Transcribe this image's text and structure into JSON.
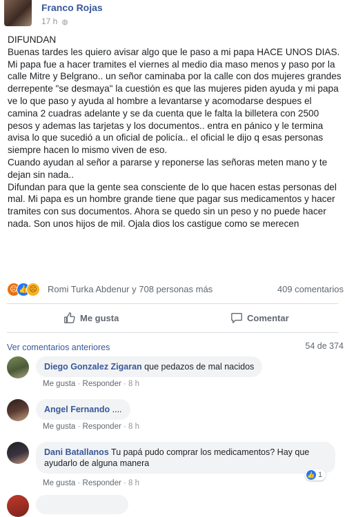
{
  "post": {
    "author": "Franco Rojas",
    "time": "17 h",
    "paragraphs": [
      "DIFUNDAN",
      "Buenas tardes les quiero avisar algo que le paso a mi papa HACE UNOS DIAS.",
      "Mi papa fue a hacer tramites el viernes al medio dia maso menos y paso por la calle Mitre y Belgrano.. un señor caminaba por la calle con dos mujeres grandes derrepente \"se desmaya\" la cuestión es que las mujeres piden ayuda y mi papa ve lo que paso y ayuda al hombre a levantarse y acomodarse despues el camina 2 cuadras adelante y se da cuenta que le falta la billetera con 2500 pesos y ademas las tarjetas y los documentos.. entra en pánico y le termina avisa lo que sucedió a un oficial de policía.. el oficial le dijo q esas personas siempre hacen lo mismo viven de eso.",
      "Cuando ayudan al señor a pararse y reponerse las señoras meten mano y te dejan sin nada..",
      "Difundan para que la gente sea consciente de lo que hacen estas personas del mal. Mi papa es un hombre grande tiene que pagar sus medicamentos y hacer tramites con sus documentos. Ahora se quedo sin un peso y no puede hacer nada. Son unos hijos de mil. Ojala dios los castigue como se merecen"
    ],
    "reactions_text": "Romi Turka Abdenur y 708 personas más",
    "comments_count": "409 comentarios"
  },
  "actions": {
    "like": "Me gusta",
    "comment": "Comentar"
  },
  "comments_section": {
    "previous_link": "Ver comentarios anteriores",
    "page_count": "54 de 374",
    "items": [
      {
        "name": "Diego Gonzalez Zigaran",
        "text": "que pedazos de mal nacidos",
        "like": "Me gusta",
        "reply": "Responder",
        "time": "8 h"
      },
      {
        "name": "Angel Fernando",
        "text": "....",
        "like": "Me gusta",
        "reply": "Responder",
        "time": "8 h"
      },
      {
        "name": "Dani Batallanos",
        "text": "Tu papá pudo comprar los medicamentos? Hay que ayudarlo de alguna manera",
        "like": "Me gusta",
        "reply": "Responder",
        "time": "8 h",
        "likes": "1"
      }
    ]
  },
  "colors": {
    "link_blue": "#385898",
    "like_blue": "#2078f4",
    "bubble_bg": "#f2f3f5"
  },
  "icons": {
    "reaction_angry": "angry-icon",
    "reaction_like": "like-icon",
    "reaction_sad": "sad-icon",
    "action_like": "thumbs-up-icon",
    "action_comment": "comment-icon"
  }
}
